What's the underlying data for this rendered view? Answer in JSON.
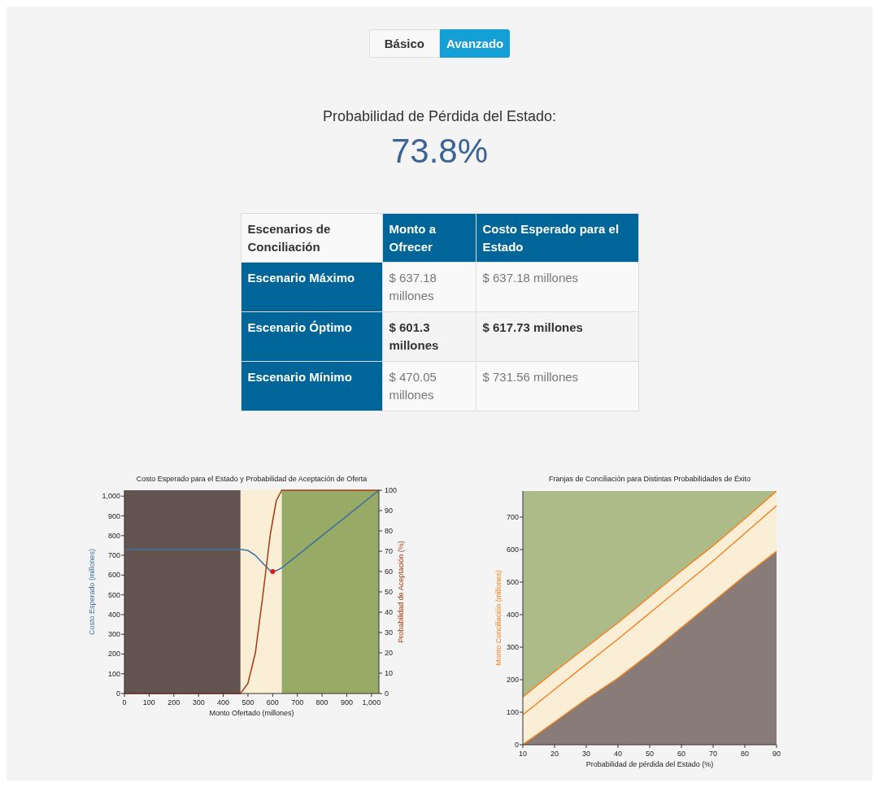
{
  "mode_toggle": [
    {
      "label": "Básico",
      "selected": false
    },
    {
      "label": "Avanzado",
      "selected": true
    }
  ],
  "headline": {
    "label": "Probabilidad de Pérdida del Estado:",
    "value": "73.8%"
  },
  "table": {
    "columns": [
      "Escenarios de Conciliación",
      "Monto a Ofrecer",
      "Costo Esperado para el Estado"
    ],
    "rows": [
      {
        "cells": [
          "Escenario Máximo",
          "$ 637.18 millones",
          "$ 637.18 millones"
        ],
        "highlighted": false
      },
      {
        "cells": [
          "Escenario Óptimo",
          "$ 601.3 millones",
          "$ 617.73 millones"
        ],
        "highlighted": true
      },
      {
        "cells": [
          "Escenario Mínimo",
          "$ 470.05 millones",
          "$ 731.56 millones"
        ],
        "highlighted": false
      }
    ]
  },
  "charts": [
    {
      "chart_data": {
        "type": "line",
        "title": "Costo Esperado para el Estado y Probabilidad de Aceptación de Oferta",
        "xlabel": "Monto Ofertado (millones)",
        "ylabel": "Costo Esperado (millones)",
        "y2label": "Probabilidad de Aceptación (%)",
        "x": [
          0,
          470,
          500,
          530,
          560,
          590,
          600,
          615,
          637,
          700,
          800,
          900,
          1030
        ],
        "series": [
          {
            "color": "#3e6fa0",
            "values": [
              730,
              730,
              725,
              700,
              660,
              622,
              618,
              622,
              637,
              700,
              800,
              900,
              1030
            ]
          },
          {
            "color": "#a33a12",
            "axis": "y2",
            "values": [
              0,
              0,
              5,
              20,
              48,
              78,
              85,
              95,
              100,
              100,
              100,
              100,
              100
            ]
          }
        ],
        "xlim": [
          0,
          1030
        ],
        "ylim": [
          0,
          1030
        ],
        "y2lim": [
          0,
          100
        ],
        "xticks": [
          0,
          100,
          200,
          300,
          400,
          500,
          600,
          700,
          800,
          900,
          {
            "value": 1000,
            "label": "1,000"
          }
        ],
        "yticks": [
          0,
          100,
          200,
          300,
          400,
          500,
          600,
          700,
          800,
          900,
          {
            "value": 1000,
            "label": "1,000"
          }
        ],
        "y2ticks": [
          0,
          10,
          20,
          30,
          40,
          50,
          60,
          70,
          80,
          90,
          100
        ],
        "bands": [
          {
            "axis": "x",
            "from": 0,
            "to": 470,
            "color": "#635451"
          },
          {
            "axis": "x",
            "from": 470,
            "to": 637,
            "color": "#faeed6"
          },
          {
            "axis": "x",
            "from": 637,
            "to": 1030,
            "color": "#98ab66"
          }
        ]
      }
    },
    {
      "chart_data": {
        "type": "area",
        "title": "Franjas de Conciliación para Distintas Probabilidades de Éxito",
        "xlabel": "Probabilidad de pérdida del Estado (%)",
        "ylabel": "Monto Conciliación (millones)",
        "x": [
          10,
          20,
          30,
          40,
          50,
          60,
          70,
          80,
          90
        ],
        "series": [
          {
            "color": "#f58220",
            "values": [
              0,
              70,
              140,
              205,
              280,
              360,
              440,
              520,
              595
            ]
          },
          {
            "color": "#f58220",
            "values": [
              92,
              170,
              248,
              325,
              405,
              485,
              565,
              650,
              735
            ]
          },
          {
            "color": "#f58220",
            "values": [
              147,
              225,
              300,
              375,
              455,
              535,
              612,
              695,
              780
            ]
          }
        ],
        "xlim": [
          10,
          90
        ],
        "ylim": [
          0,
          780
        ],
        "xticks": [
          10,
          20,
          30,
          40,
          50,
          60,
          70,
          80,
          90
        ],
        "yticks": [
          0,
          100,
          200,
          300,
          400,
          500,
          600,
          700
        ]
      }
    }
  ]
}
